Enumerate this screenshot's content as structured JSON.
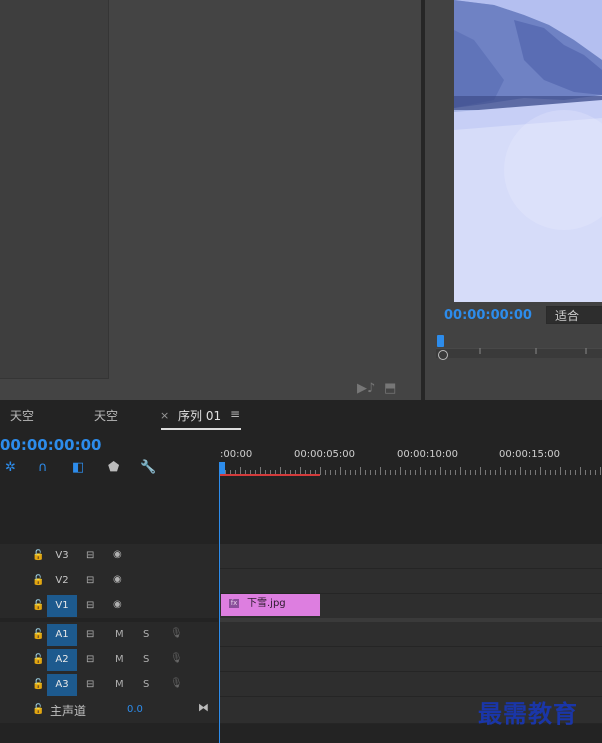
{
  "source_monitor": {
    "timecode": "00:00:00:00",
    "fit_label": "适合"
  },
  "timeline": {
    "tabs": [
      {
        "label": "天空"
      },
      {
        "label": "天空"
      },
      {
        "label": "序列 01",
        "close": "×",
        "menu": "≡"
      }
    ],
    "timecode": "00:00:00:00",
    "ruler_labels": [
      ":00:00",
      "00:00:05:00",
      "00:00:10:00",
      "00:00:15:00"
    ],
    "video_tracks": [
      {
        "name": "V3",
        "active": false
      },
      {
        "name": "V2",
        "active": false
      },
      {
        "name": "V1",
        "active": true
      }
    ],
    "audio_tracks": [
      {
        "name": "A1",
        "mute": "M",
        "solo": "S"
      },
      {
        "name": "A2",
        "mute": "M",
        "solo": "S"
      },
      {
        "name": "A3",
        "mute": "M",
        "solo": "S"
      }
    ],
    "master": {
      "label": "主声道",
      "value": "0.0"
    },
    "clip": {
      "fx": "fx",
      "name": "下雪.jpg"
    }
  },
  "watermark": "最需教育",
  "icons": {
    "lock": "lock-icon",
    "film": "film-icon",
    "eye": "eye-icon",
    "mic": "mic-icon",
    "snap": "snap-icon",
    "magnet": "magnet-icon",
    "marker": "marker-icon",
    "wrench": "wrench-icon",
    "insert": "insert-icon",
    "export-frame": "export-frame-icon"
  },
  "colors": {
    "accent": "#2d8ceb",
    "clip": "#dd7ee0",
    "work_area": "#d43b3b",
    "active_track": "#1d5a8e"
  }
}
